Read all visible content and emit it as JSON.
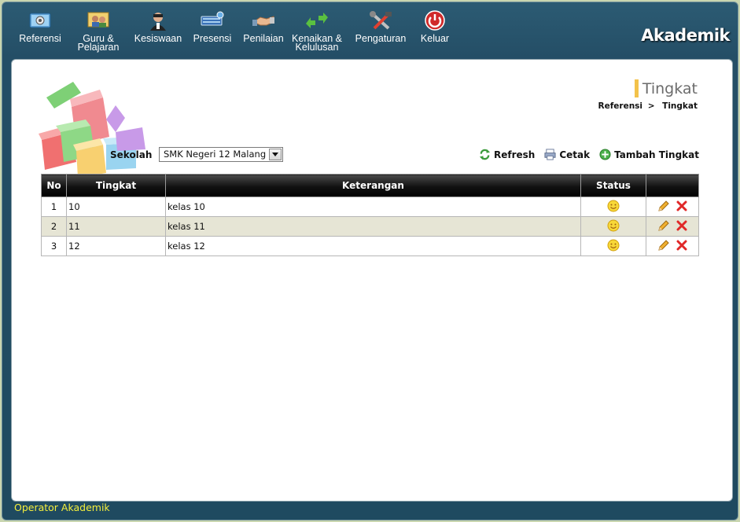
{
  "menu": [
    {
      "label": "Referensi",
      "icon": "gear-icon"
    },
    {
      "label": "Guru &\nPelajaran",
      "icon": "teacher-icon"
    },
    {
      "label": "Kesiswaan",
      "icon": "student-icon"
    },
    {
      "label": "Presensi",
      "icon": "keyboard-icon"
    },
    {
      "label": "Penilaian",
      "icon": "handshake-icon"
    },
    {
      "label": "Kenaikan &\nKelulusan",
      "icon": "arrows-icon"
    },
    {
      "label": "Pengaturan",
      "icon": "tools-icon"
    },
    {
      "label": "Keluar",
      "icon": "power-icon"
    }
  ],
  "brand": "Akademik",
  "page": {
    "title": "Tingkat",
    "breadcrumb": [
      "Referensi",
      ">",
      "Tingkat"
    ]
  },
  "filter": {
    "label": "Sekolah",
    "selected": "SMK Negeri 12 Malang"
  },
  "actions": {
    "refresh": "Refresh",
    "print": "Cetak",
    "add": "Tambah Tingkat"
  },
  "table": {
    "headers": [
      "No",
      "Tingkat",
      "Keterangan",
      "Status",
      ""
    ],
    "rows": [
      {
        "no": "1",
        "tingkat": "10",
        "keterangan": "kelas 10",
        "status": "active"
      },
      {
        "no": "2",
        "tingkat": "11",
        "keterangan": "kelas 11",
        "status": "active"
      },
      {
        "no": "3",
        "tingkat": "12",
        "keterangan": "kelas 12",
        "status": "active"
      }
    ]
  },
  "status_bar": "Operator Akademik",
  "colors": {
    "header_bg": "#244e66",
    "brand_text": "#ffffff",
    "status_text": "#f4ee3c",
    "alt_row": "#e6e5d5",
    "title_accent": "#f3c24a"
  }
}
